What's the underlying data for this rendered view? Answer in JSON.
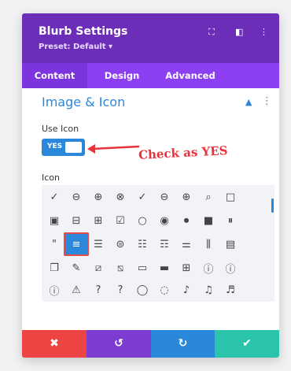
{
  "header": {
    "title": "Blurb Settings",
    "preset": "Preset: Default ▾"
  },
  "tabs": [
    "Content",
    "Design",
    "Advanced"
  ],
  "section": {
    "title": "Image & Icon"
  },
  "use_icon": {
    "label": "Use Icon",
    "toggle_text": "YES"
  },
  "annotation": "Check as YES",
  "icon_section": {
    "label": "Icon"
  },
  "footer": {
    "cancel": "✖",
    "undo": "↺",
    "redo": "↻",
    "save": "✔"
  },
  "colors": {
    "header": "#6c2eb9",
    "tabs": "#8b3ff0",
    "accent": "#2b87da",
    "cancel": "#ef4444",
    "undo": "#7e3bd0",
    "redo": "#2b87da",
    "save": "#29c4a9",
    "annotation": "#e8323c"
  }
}
